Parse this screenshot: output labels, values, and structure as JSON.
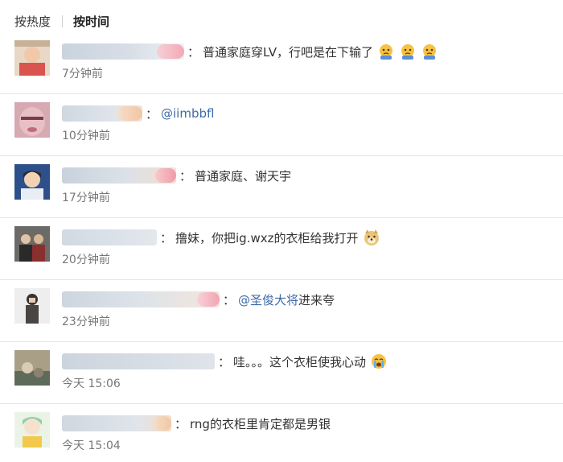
{
  "sort_tabs": {
    "hot": "按热度",
    "time": "按时间"
  },
  "comments": [
    {
      "prefix": "",
      "text": "普通家庭穿LV，行吧是在下输了",
      "time": "7分钟前",
      "emoji": [
        "sad-cry-emoji",
        "sad-cry-emoji",
        "sad-cry-emoji"
      ]
    },
    {
      "prefix": "@iimbbfl",
      "text": "",
      "time": "10分钟前",
      "emoji": []
    },
    {
      "prefix": "",
      "text": "普通家庭、谢天宇",
      "time": "17分钟前",
      "emoji": []
    },
    {
      "prefix": "",
      "text": "撸妹，你把ig.wxz的衣柜给我打开",
      "time": "20分钟前",
      "emoji": [
        "doge-emoji"
      ]
    },
    {
      "prefix": "@圣俊大将",
      "text": " 进来夸",
      "time": "23分钟前",
      "emoji": []
    },
    {
      "prefix": "",
      "text": "哇。。。这个衣柜使我心动",
      "time": "今天 15:06",
      "emoji": [
        "crying-emoji"
      ]
    },
    {
      "prefix": "",
      "text": "rng的衣柜里肯定都是男银",
      "time": "今天 15:04",
      "emoji": []
    }
  ],
  "colon": "："
}
